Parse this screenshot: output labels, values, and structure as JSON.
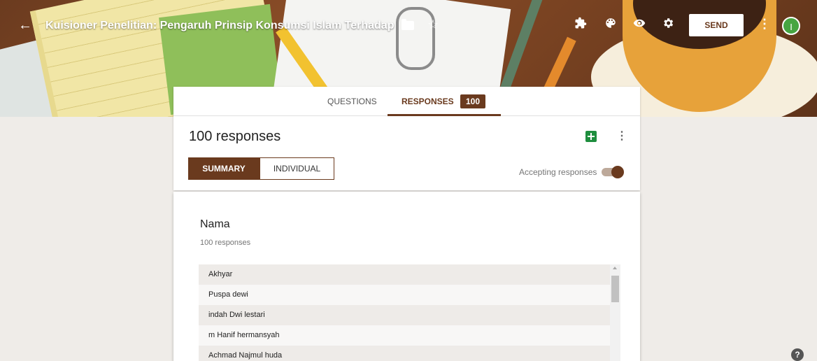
{
  "header": {
    "form_title": "Kuisioner Penelitian: Pengaruh Prinsip Konsumsi Islam Terhadap",
    "send_label": "SEND",
    "avatar_initial": "I",
    "icons": [
      "back-arrow-icon",
      "folder-icon",
      "star-icon",
      "puzzle-icon",
      "palette-icon",
      "eye-icon",
      "gear-icon",
      "more-vert-icon"
    ]
  },
  "tabs": {
    "questions": "QUESTIONS",
    "responses": "RESPONSES",
    "response_count": "100"
  },
  "summary": {
    "title": "100 responses",
    "segment_summary": "SUMMARY",
    "segment_individual": "INDIVIDUAL",
    "accepting_label": "Accepting responses",
    "accepting": true
  },
  "question": {
    "title": "Nama",
    "count": "100 responses",
    "answers": [
      "Akhyar",
      "Puspa dewi",
      "indah Dwi lestari",
      "m Hanif hermansyah",
      "Achmad Najmul huda"
    ]
  },
  "colors": {
    "accent": "#6a3a1e",
    "sheets_green": "#1e8e3e",
    "avatar_green": "#46a541",
    "page_bg": "#efece8"
  }
}
